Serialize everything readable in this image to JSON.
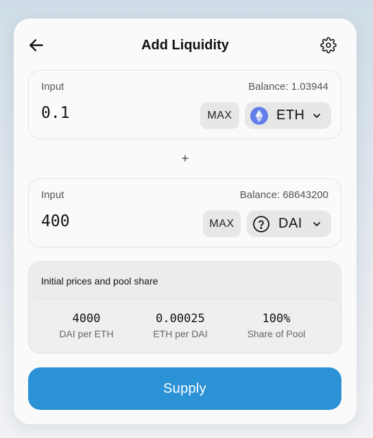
{
  "header": {
    "title": "Add Liquidity",
    "back_icon": "arrow-left-icon",
    "settings_icon": "gear-icon"
  },
  "inputs": [
    {
      "label": "Input",
      "balance": "Balance: 1.03944",
      "value": "0.1",
      "max_label": "MAX",
      "token": {
        "symbol": "ETH",
        "icon": "ethereum-icon",
        "color": "#627eea"
      }
    },
    {
      "label": "Input",
      "balance": "Balance: 68643200",
      "value": "400",
      "max_label": "MAX",
      "token": {
        "symbol": "DAI",
        "icon": "question-circle-icon"
      }
    }
  ],
  "plus": "+",
  "pool": {
    "title": "Initial prices and pool share",
    "stats": [
      {
        "value": "4000",
        "label": "DAI per ETH"
      },
      {
        "value": "0.00025",
        "label": "ETH per DAI"
      },
      {
        "value": "100%",
        "label": "Share of Pool"
      }
    ]
  },
  "supply_label": "Supply",
  "colors": {
    "accent": "#2b92d6",
    "eth": "#627eea"
  }
}
